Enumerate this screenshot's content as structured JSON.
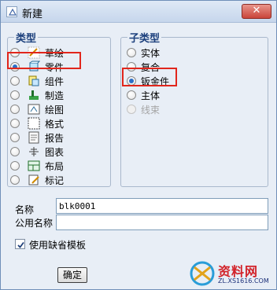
{
  "window": {
    "title": "新建",
    "close_label": "✕"
  },
  "type_group": {
    "legend": "类型",
    "items": [
      {
        "label": "草绘",
        "icon": "sketch-icon",
        "checked": false
      },
      {
        "label": "零件",
        "icon": "part-icon",
        "checked": true
      },
      {
        "label": "组件",
        "icon": "assembly-icon",
        "checked": false
      },
      {
        "label": "制造",
        "icon": "manufacturing-icon",
        "checked": false
      },
      {
        "label": "绘图",
        "icon": "drawing-icon",
        "checked": false
      },
      {
        "label": "格式",
        "icon": "format-icon",
        "checked": false
      },
      {
        "label": "报告",
        "icon": "report-icon",
        "checked": false
      },
      {
        "label": "图表",
        "icon": "diagram-icon",
        "checked": false
      },
      {
        "label": "布局",
        "icon": "layout-icon",
        "checked": false
      },
      {
        "label": "标记",
        "icon": "markup-icon",
        "checked": false
      }
    ]
  },
  "subtype_group": {
    "legend": "子类型",
    "items": [
      {
        "label": "实体",
        "checked": false,
        "enabled": true
      },
      {
        "label": "复合",
        "checked": false,
        "enabled": true
      },
      {
        "label": "钣金件",
        "checked": true,
        "enabled": true
      },
      {
        "label": "主体",
        "checked": false,
        "enabled": true
      },
      {
        "label": "线束",
        "checked": false,
        "enabled": false
      }
    ]
  },
  "name_field": {
    "label": "名称",
    "value": "blk0001"
  },
  "common_name_field": {
    "label": "公用名称",
    "value": ""
  },
  "default_template": {
    "label": "使用缺省模板",
    "checked": true
  },
  "ok_button": {
    "label": "确定"
  },
  "watermark": {
    "brand": "资料网",
    "url": "ZL.XS1616.COM"
  }
}
